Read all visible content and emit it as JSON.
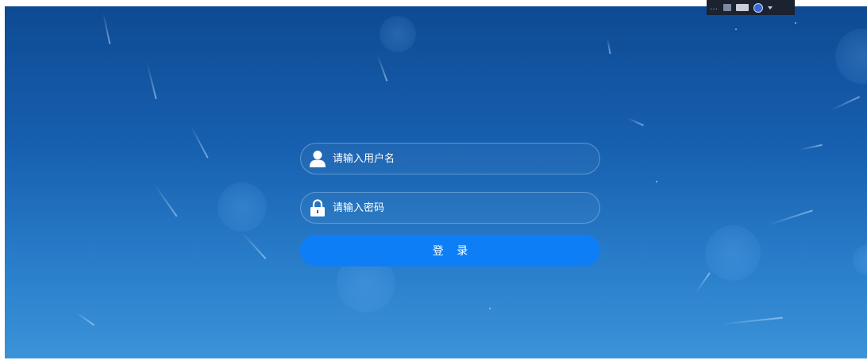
{
  "login_form": {
    "username_placeholder": "请输入用户名",
    "password_placeholder": "请输入密码",
    "submit_label": "登 录"
  },
  "icons": {
    "username": "user-icon",
    "password": "lock-icon"
  },
  "colors": {
    "background_top": "#0e4a93",
    "background_bottom": "#3b93d8",
    "button": "#0e7ef6",
    "field_border": "#aacdf0"
  }
}
